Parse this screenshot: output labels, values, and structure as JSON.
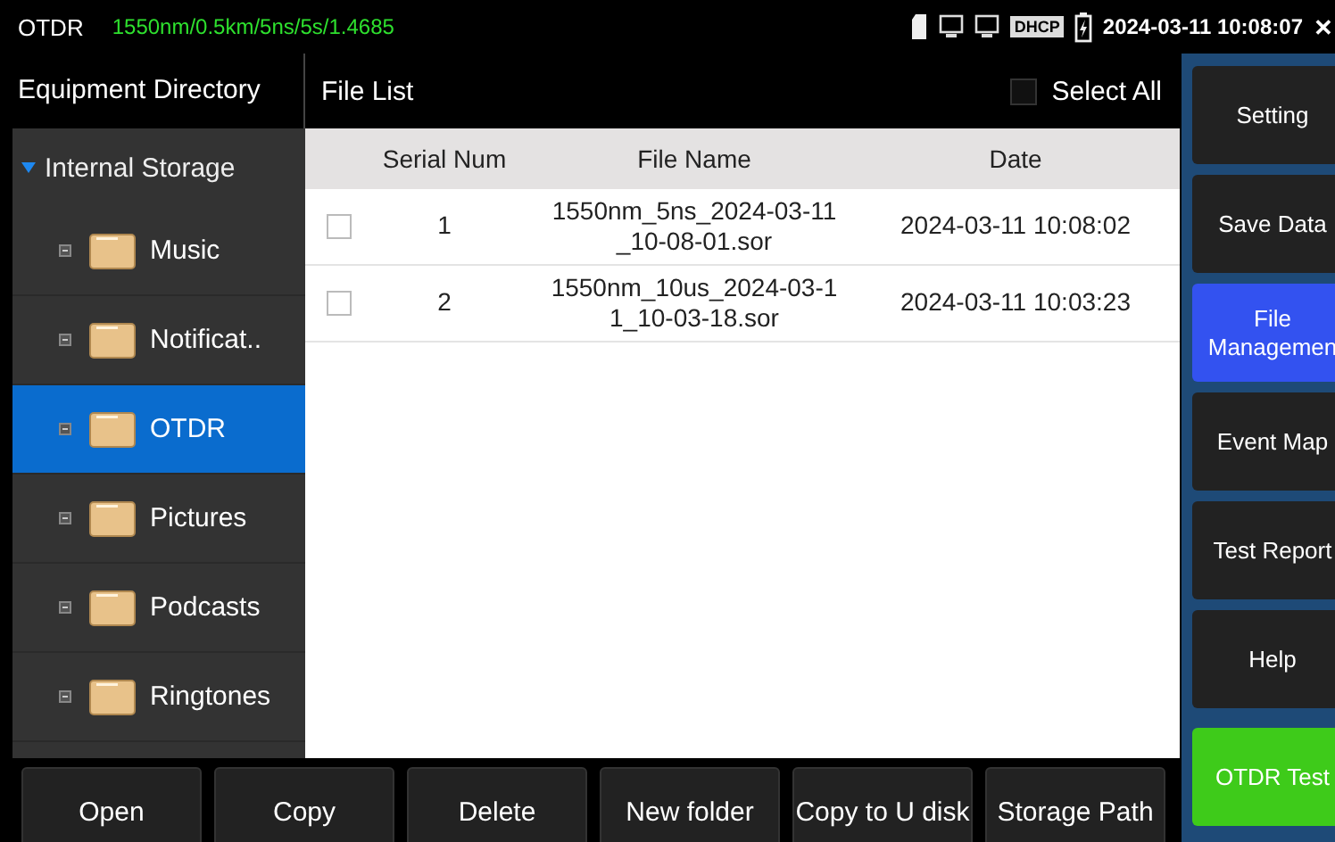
{
  "status_bar": {
    "app": "OTDR",
    "params": "1550nm/0.5km/5ns/5s/1.4685",
    "dhcp_label": "DHCP",
    "datetime": "2024-03-11 10:08:07",
    "close": "✕"
  },
  "sidebar": {
    "title": "Equipment Directory",
    "root": {
      "label": "Internal Storage",
      "expanded": true,
      "children": [
        {
          "label": "Music",
          "selected": false
        },
        {
          "label": "Notificat..",
          "selected": false
        },
        {
          "label": "OTDR",
          "selected": true
        },
        {
          "label": "Pictures",
          "selected": false
        },
        {
          "label": "Podcasts",
          "selected": false
        },
        {
          "label": "Ringtones",
          "selected": false
        }
      ]
    }
  },
  "file_list": {
    "title": "File List",
    "select_all": {
      "label": "Select All",
      "checked": false
    },
    "columns": [
      "Serial Num",
      "File Name",
      "Date"
    ],
    "rows": [
      {
        "checked": false,
        "cells": [
          "1",
          "1550nm_5ns_2024-03-11_10-08-01.sor",
          "2024-03-11 10:08:02"
        ]
      },
      {
        "checked": false,
        "cells": [
          "2",
          "1550nm_10us_2024-03-11_10-03-18.sor",
          "2024-03-11 10:03:23"
        ]
      }
    ]
  },
  "menu": [
    {
      "label": "Setting",
      "kind": "nav",
      "selected": false
    },
    {
      "label": "Save Data",
      "kind": "nav",
      "selected": false
    },
    {
      "label": "File Managemen",
      "kind": "nav",
      "selected": true
    },
    {
      "label": "Event Map",
      "kind": "nav",
      "selected": false
    },
    {
      "label": "Test Report",
      "kind": "nav",
      "selected": false
    },
    {
      "label": "Help",
      "kind": "nav",
      "selected": false
    },
    {
      "label": "OTDR Test",
      "kind": "action",
      "selected": false
    }
  ],
  "actions": [
    "Open",
    "Copy",
    "Delete",
    "New folder",
    "Copy to U disk",
    "Storage Path"
  ]
}
